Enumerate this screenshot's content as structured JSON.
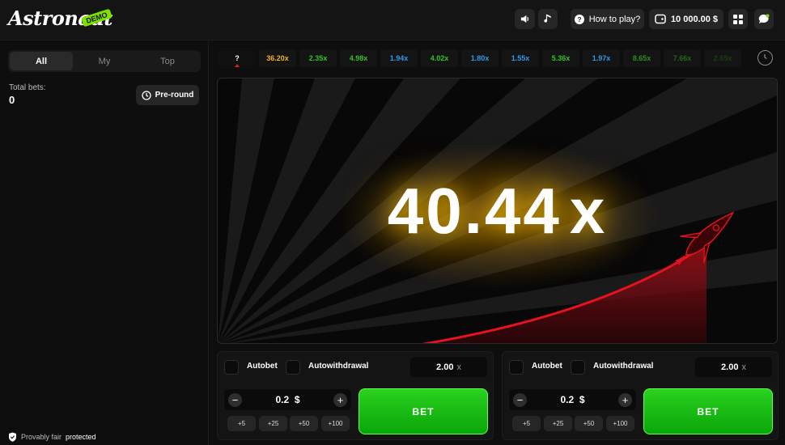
{
  "header": {
    "logo_text": "Astronaut",
    "demo_badge": "DEMO",
    "how_to_play": "How to play?",
    "balance": "10 000.00 $",
    "icons": [
      "volume-icon",
      "music-icon",
      "help-icon",
      "wallet-icon",
      "grid-menu-icon",
      "chat-icon"
    ]
  },
  "left_panel": {
    "tabs": [
      {
        "label": "All",
        "active": true
      },
      {
        "label": "My",
        "active": false
      },
      {
        "label": "Top",
        "active": false
      }
    ],
    "total_bets_label": "Total bets:",
    "total_bets_value": "0",
    "preround_label": "Pre-round",
    "fair_label": "Provably fair",
    "fair_status": "protected"
  },
  "history": [
    {
      "value": "?",
      "color": "#ffffff"
    },
    {
      "value": "36.20x",
      "color": "#f5b21d"
    },
    {
      "value": "2.35x",
      "color": "#34c324"
    },
    {
      "value": "4.98x",
      "color": "#34c324"
    },
    {
      "value": "1.94x",
      "color": "#2f9ae8"
    },
    {
      "value": "4.02x",
      "color": "#34c324"
    },
    {
      "value": "1.80x",
      "color": "#2f9ae8"
    },
    {
      "value": "1.55x",
      "color": "#2f9ae8"
    },
    {
      "value": "5.36x",
      "color": "#34c324"
    },
    {
      "value": "1.97x",
      "color": "#2f9ae8"
    },
    {
      "value": "8.65x",
      "color": "#2a8f20"
    },
    {
      "value": "7.66x",
      "color": "#1f6a18"
    },
    {
      "value": "2.65x",
      "color": "#1e3a18"
    }
  ],
  "game": {
    "multiplier": "40.44",
    "multiplier_suffix": "x",
    "accent_glow": "#ffc400",
    "curve_color": "#c8101a"
  },
  "bet_panels": [
    {
      "autobet_label": "Autobet",
      "autowithdrawal_label": "Autowithdrawal",
      "autowithdrawal_value": "2.00",
      "autowithdrawal_unit": "x",
      "amount": "0.2",
      "currency": "$",
      "quick_amounts": [
        "+5",
        "+25",
        "+50",
        "+100"
      ],
      "bet_label": "BET"
    },
    {
      "autobet_label": "Autobet",
      "autowithdrawal_label": "Autowithdrawal",
      "autowithdrawal_value": "2.00",
      "autowithdrawal_unit": "x",
      "amount": "0.2",
      "currency": "$",
      "quick_amounts": [
        "+5",
        "+25",
        "+50",
        "+100"
      ],
      "bet_label": "BET"
    }
  ]
}
